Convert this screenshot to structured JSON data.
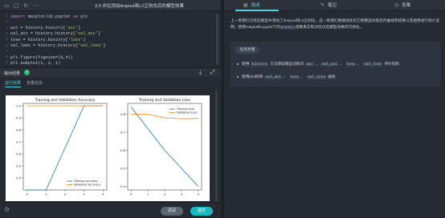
{
  "header": {
    "title": "3.5 评估添加dropout和L2正则化后的模型效果"
  },
  "code": {
    "lines": [
      {
        "num": "1",
        "text": "import matplotlib.pyplot as plt"
      },
      {
        "num": "2",
        "text": ""
      },
      {
        "num": "3",
        "text": "acc = history.history['acc']"
      },
      {
        "num": "4",
        "text": "val_acc = history.history['val_acc']"
      },
      {
        "num": "5",
        "text": "loss = history.history['loss']"
      },
      {
        "num": "6",
        "text": "val_loss = history.history['val_loss']"
      },
      {
        "num": "7",
        "text": ""
      },
      {
        "num": "8",
        "text": "plt.figure(figsize=(8,4))"
      },
      {
        "num": "9",
        "text": "plt.subplot(1, 2, 1)"
      }
    ]
  },
  "output": {
    "label": "输出结果",
    "tabs": [
      "运行结果",
      "变量信息"
    ]
  },
  "chart_data": [
    {
      "type": "line",
      "title": "Training and Validation Accuracy",
      "x": [
        0,
        1,
        2,
        3,
        4
      ],
      "series": [
        {
          "name": "Training Accuracy",
          "values": [
            0.3,
            0.3,
            0.65,
            1.0,
            1.0
          ]
        },
        {
          "name": "Validation Accuracy",
          "values": [
            1.0,
            1.0,
            1.0,
            1.0,
            1.0
          ]
        }
      ],
      "xticks": [
        "0",
        "1",
        "2",
        "3",
        "4"
      ],
      "yticks": [
        "0.4",
        "0.5",
        "0.6",
        "0.7",
        "0.8",
        "0.9",
        "1.0"
      ],
      "ylim": [
        0.3,
        1.02
      ],
      "legend": "lower-right",
      "colors": [
        "#1f77b4",
        "#ff7f0e"
      ]
    },
    {
      "type": "line",
      "title": "Training and Validation Loss",
      "x": [
        0,
        1,
        2,
        3,
        4
      ],
      "series": [
        {
          "name": "Training Loss",
          "values": [
            0.84,
            0.72,
            0.6,
            0.5,
            0.4
          ]
        },
        {
          "name": "Validation Loss",
          "values": [
            0.8,
            0.8,
            0.78,
            0.775,
            0.777
          ]
        }
      ],
      "xticks": [
        "0",
        "1",
        "2",
        "3",
        "4"
      ],
      "yticks": [
        "0.4",
        "0.5",
        "0.6",
        "0.7",
        "0.8"
      ],
      "ylim": [
        0.38,
        0.86
      ],
      "legend": "upper-right",
      "colors": [
        "#1f77b4",
        "#ff7f0e"
      ]
    }
  ],
  "buttons": {
    "run": "调试",
    "submit": "提交"
  },
  "right": {
    "tabs": [
      "描述",
      "笔记",
      "答案"
    ],
    "description_parts": [
      "上一章我们已经在模型中添加了dropout和L2正则化。这一章我们要继续优化它把模型训练后的曲线和结果以及图像进行统计说明，使用matplotlib.pyplot下的",
      "plot()",
      "函数来实现对优化后模型效果的可视化。"
    ],
    "task": {
      "title": "任务步骤",
      "bullet1": [
        "使用",
        "history",
        "方法获取模型训练的",
        "acc",
        "、",
        "val_acc",
        "、",
        "loss",
        "、",
        "val_loss",
        "评价指标"
      ],
      "bullet2": [
        "使用plot绘制",
        "val_acc",
        "、",
        "loss",
        "、",
        "val_loss",
        "曲线"
      ]
    }
  },
  "colors": {
    "accent": "#4fd1d9",
    "submit": "#19b8c4",
    "success": "#2fb873"
  }
}
